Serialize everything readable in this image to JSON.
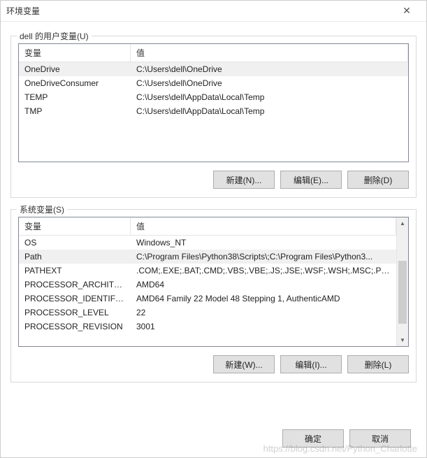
{
  "window": {
    "title": "环境变量"
  },
  "userSection": {
    "label": "dell 的用户变量(U)",
    "header": {
      "name": "变量",
      "value": "值"
    },
    "rows": [
      {
        "name": "OneDrive",
        "value": "C:\\Users\\dell\\OneDrive"
      },
      {
        "name": "OneDriveConsumer",
        "value": "C:\\Users\\dell\\OneDrive"
      },
      {
        "name": "TEMP",
        "value": "C:\\Users\\dell\\AppData\\Local\\Temp"
      },
      {
        "name": "TMP",
        "value": "C:\\Users\\dell\\AppData\\Local\\Temp"
      }
    ],
    "buttons": {
      "new": "新建(N)...",
      "edit": "编辑(E)...",
      "delete": "删除(D)"
    }
  },
  "systemSection": {
    "label": "系统变量(S)",
    "header": {
      "name": "变量",
      "value": "值"
    },
    "rows": [
      {
        "name": "OS",
        "value": "Windows_NT"
      },
      {
        "name": "Path",
        "value": "C:\\Program Files\\Python38\\Scripts\\;C:\\Program Files\\Python3..."
      },
      {
        "name": "PATHEXT",
        "value": ".COM;.EXE;.BAT;.CMD;.VBS;.VBE;.JS;.JSE;.WSF;.WSH;.MSC;.PY;.P..."
      },
      {
        "name": "PROCESSOR_ARCHITECT...",
        "value": "AMD64"
      },
      {
        "name": "PROCESSOR_IDENTIFIER",
        "value": "AMD64 Family 22 Model 48 Stepping 1, AuthenticAMD"
      },
      {
        "name": "PROCESSOR_LEVEL",
        "value": "22"
      },
      {
        "name": "PROCESSOR_REVISION",
        "value": "3001"
      }
    ],
    "buttons": {
      "new": "新建(W)...",
      "edit": "编辑(I)...",
      "delete": "删除(L)"
    }
  },
  "dialog": {
    "ok": "确定",
    "cancel": "取消"
  },
  "watermark": "https://blog.csdn.net/Python_Charlotte"
}
